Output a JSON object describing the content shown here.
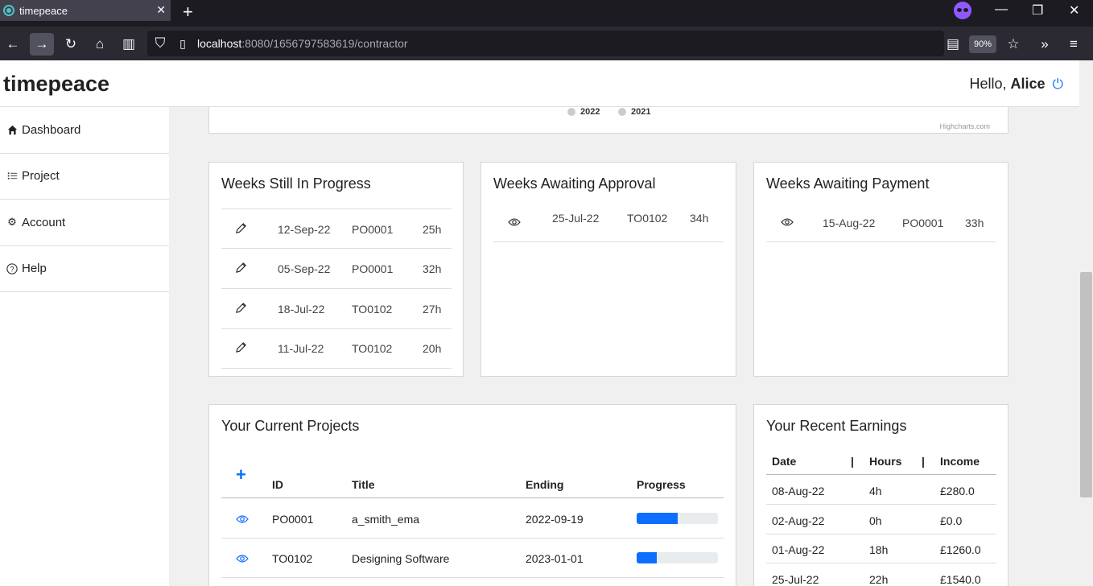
{
  "browser": {
    "tab_title": "timepeace",
    "tab_close": "✕",
    "new_tab": "+",
    "url_host": "localhost",
    "url_rest": ":8080/1656797583619/contractor",
    "zoom": "90%"
  },
  "header": {
    "brand": "timepeace",
    "greeting": "Hello,",
    "user": "Alice"
  },
  "sidebar": {
    "items": [
      {
        "label": "Dashboard",
        "icon": "home-icon"
      },
      {
        "label": "Project",
        "icon": "list-icon"
      },
      {
        "label": "Account",
        "icon": "gear-icon"
      },
      {
        "label": "Help",
        "icon": "question-icon"
      }
    ]
  },
  "chart_legend": {
    "items": [
      "2022",
      "2021"
    ],
    "credit": "Highcharts.com",
    "colors": [
      "#cccccc",
      "#cccccc"
    ]
  },
  "in_progress": {
    "title": "Weeks Still In Progress",
    "rows": [
      {
        "date": "12-Sep-22",
        "po": "PO0001",
        "hours": "25h"
      },
      {
        "date": "05-Sep-22",
        "po": "PO0001",
        "hours": "32h"
      },
      {
        "date": "18-Jul-22",
        "po": "TO0102",
        "hours": "27h"
      },
      {
        "date": "11-Jul-22",
        "po": "TO0102",
        "hours": "20h"
      }
    ]
  },
  "awaiting_approval": {
    "title": "Weeks Awaiting Approval",
    "rows": [
      {
        "date": "25-Jul-22",
        "po": "TO0102",
        "hours": "34h"
      }
    ]
  },
  "awaiting_payment": {
    "title": "Weeks Awaiting Payment",
    "rows": [
      {
        "date": "15-Aug-22",
        "po": "PO0001",
        "hours": "33h"
      }
    ]
  },
  "projects": {
    "title": "Your Current Projects",
    "add": "+",
    "headers": {
      "id": "ID",
      "title": "Title",
      "ending": "Ending",
      "progress": "Progress"
    },
    "rows": [
      {
        "id": "PO0001",
        "title": "a_smith_ema",
        "ending": "2022-09-19",
        "progress": 0.5
      },
      {
        "id": "TO0102",
        "title": "Designing Software",
        "ending": "2023-01-01",
        "progress": 0.25
      }
    ]
  },
  "earnings": {
    "title": "Your Recent Earnings",
    "headers": {
      "date": "Date",
      "sep": "|",
      "hours": "Hours",
      "income": "Income"
    },
    "rows": [
      {
        "date": "08-Aug-22",
        "hours": "4h",
        "income": "£280.0"
      },
      {
        "date": "02-Aug-22",
        "hours": "0h",
        "income": "£0.0"
      },
      {
        "date": "01-Aug-22",
        "hours": "18h",
        "income": "£1260.0"
      },
      {
        "date": "25-Jul-22",
        "hours": "22h",
        "income": "£1540.0"
      }
    ]
  },
  "colors": {
    "accent": "#0d6efd",
    "progress_track": "#e9ecef"
  }
}
